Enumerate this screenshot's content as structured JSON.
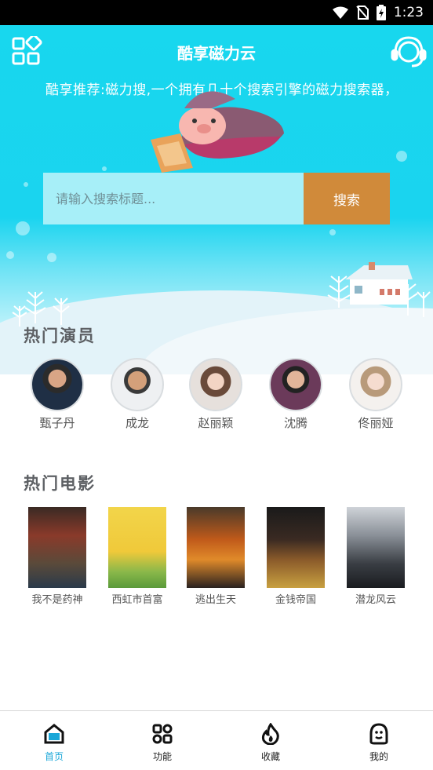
{
  "status_bar": {
    "time": "1:23"
  },
  "header": {
    "title": "酷享磁力云"
  },
  "marquee": {
    "text": "酷享推荐:磁力搜,一个拥有几十个搜索引擎的磁力搜索器，"
  },
  "search": {
    "placeholder": "请输入搜索标题...",
    "button_label": "搜索"
  },
  "actors_section": {
    "title": "热门演员",
    "items": [
      {
        "name": "甄子丹"
      },
      {
        "name": "成龙"
      },
      {
        "name": "赵丽颖"
      },
      {
        "name": "沈腾"
      },
      {
        "name": "佟丽娅"
      }
    ]
  },
  "movies_section": {
    "title": "热门电影",
    "items": [
      {
        "name": "我不是药神"
      },
      {
        "name": "西虹市首富"
      },
      {
        "name": "逃出生天"
      },
      {
        "name": "金钱帝国"
      },
      {
        "name": "潜龙风云"
      }
    ]
  },
  "tab_bar": {
    "tabs": [
      {
        "label": "首页",
        "icon": "home-icon",
        "active": true
      },
      {
        "label": "功能",
        "icon": "apps-icon"
      },
      {
        "label": "收藏",
        "icon": "flame-icon"
      },
      {
        "label": "我的",
        "icon": "profile-icon"
      }
    ]
  },
  "colors": {
    "accent": "#1aa7d8",
    "hero": "#18d7ee",
    "search_button": "#d08a3a"
  }
}
